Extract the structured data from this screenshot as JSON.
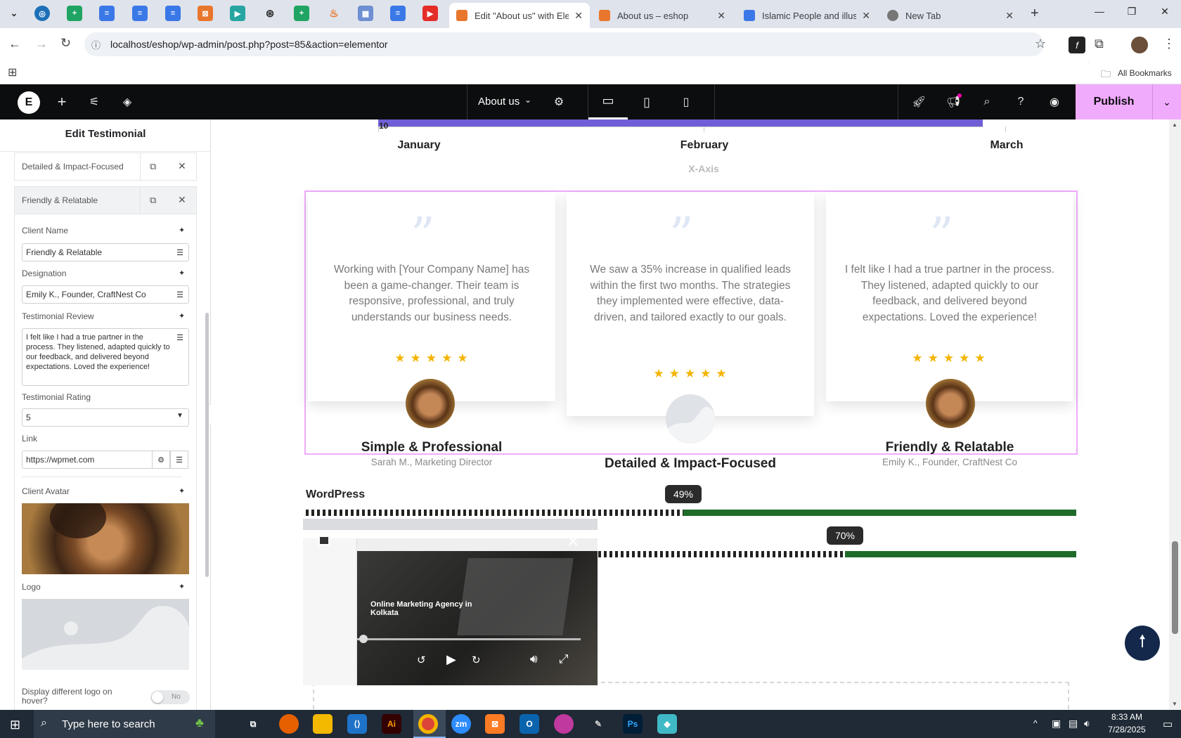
{
  "browser": {
    "tabs": [
      {
        "title": "Edit \"About us\" with Elementor",
        "active": true
      },
      {
        "title": "About us – eshop",
        "active": false
      },
      {
        "title": "Islamic People and illustrations",
        "active": false
      },
      {
        "title": "New Tab",
        "active": false
      }
    ],
    "url": "localhost/eshop/wp-admin/post.php?post=85&action=elementor",
    "bookmarks_label": "All Bookmarks"
  },
  "editor": {
    "page_name": "About us",
    "publish_label": "Publish"
  },
  "panel": {
    "title": "Edit Testimonial",
    "items": [
      {
        "label": "Detailed & Impact-Focused"
      },
      {
        "label": "Friendly & Relatable"
      }
    ],
    "fields": {
      "client_name_label": "Client Name",
      "client_name_value": "Friendly & Relatable",
      "designation_label": "Designation",
      "designation_value": "Emily K., Founder, CraftNest Co",
      "review_label": "Testimonial Review",
      "review_value": "I felt like I had a true partner in the process. They listened, adapted quickly to our feedback, and delivered beyond expectations. Loved the experience!",
      "rating_label": "Testimonial Rating",
      "rating_value": "5",
      "link_label": "Link",
      "link_value": "https://wpmet.com",
      "avatar_label": "Client Avatar",
      "logo_label": "Logo",
      "hover_logo_label": "Display different logo on hover?",
      "hover_logo_toggle": "No"
    }
  },
  "chart": {
    "y_tick": "10",
    "categories": [
      "January",
      "February",
      "March"
    ],
    "xaxis_label": "X-Axis",
    "bar_color": "#6f5fd6"
  },
  "testimonials": [
    {
      "review": "Working with [Your Company Name] has been a game-changer. Their team is responsive, professional, and truly understands our business needs.",
      "rating": 5,
      "name": "Simple & Professional",
      "designation": "Sarah M., Marketing Director",
      "avatar": "photo"
    },
    {
      "review": "We saw a 35% increase in qualified leads within the first two months. The strategies they implemented were effective, data-driven, and tailored exactly to our goals.",
      "rating": 5,
      "name": "Detailed & Impact-Focused",
      "designation": "",
      "avatar": "placeholder"
    },
    {
      "review": "I felt like I had a true partner in the process. They listened, adapted quickly to our feedback, and delivered beyond expectations. Loved the experience!",
      "rating": 5,
      "name": "Friendly & Relatable",
      "designation": "Emily K., Founder, CraftNest Co",
      "avatar": "photo"
    }
  ],
  "skills": [
    {
      "label": "WordPress",
      "value": 49,
      "value_text": "49%"
    },
    {
      "label": "",
      "value": 70,
      "value_text": "70%"
    }
  ],
  "skill_color": "#1e6b2a",
  "video_popup": {
    "caption": "Online Marketing Agency in Kolkata"
  },
  "taskbar": {
    "search_placeholder": "Type here to search",
    "time": "8:33 AM",
    "date": "7/28/2025"
  },
  "icons": {
    "back": "arrow-left-icon",
    "forward": "arrow-right-icon",
    "reload": "reload-icon",
    "star": "bookmark-star-icon"
  }
}
